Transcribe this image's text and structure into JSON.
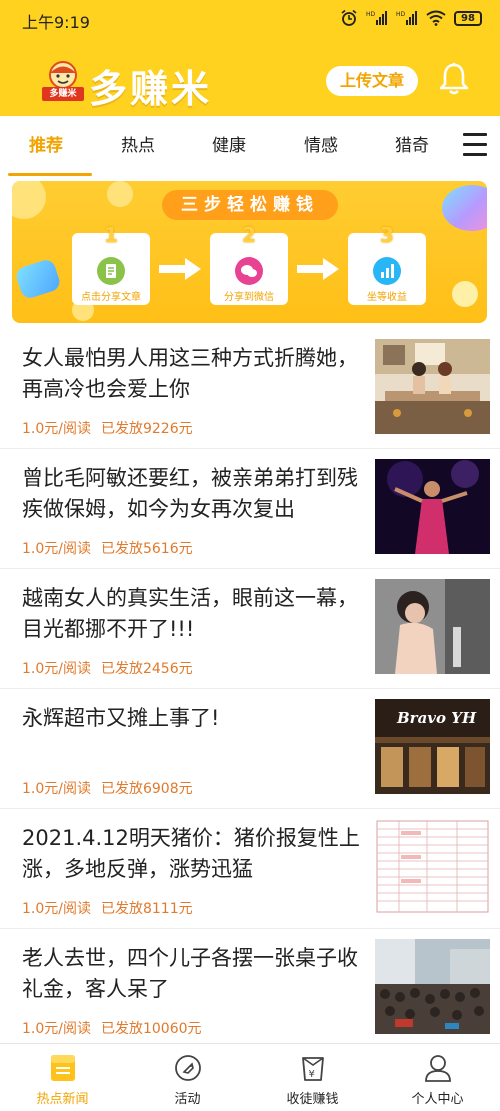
{
  "status_bar": {
    "time": "上午9:19",
    "battery": "98"
  },
  "app": {
    "name": "多赚米",
    "logo_badge": "多赚米",
    "upload_label": "上传文章"
  },
  "tabs": [
    {
      "label": "推荐",
      "active": true
    },
    {
      "label": "热点",
      "active": false
    },
    {
      "label": "健康",
      "active": false
    },
    {
      "label": "情感",
      "active": false
    },
    {
      "label": "猎奇",
      "active": false
    }
  ],
  "banner": {
    "title": "三步轻松赚钱",
    "steps": [
      {
        "num": "1",
        "label": "点击分享文章",
        "icon": "document-icon",
        "color": "#8bc34a"
      },
      {
        "num": "2",
        "label": "分享到微信",
        "icon": "wechat-icon",
        "color": "#e84393"
      },
      {
        "num": "3",
        "label": "坐等收益",
        "icon": "chart-icon",
        "color": "#29b6f6"
      }
    ]
  },
  "articles": [
    {
      "title": "女人最怕男人用这三种方式折腾她，再高冷也会爱上你",
      "price": "1.0元/阅读",
      "paid": "已发放9226元",
      "thumb": "couple-illustration"
    },
    {
      "title": "曾比毛阿敏还要红，被亲弟弟打到残疾做保姆，如今为女再次复出",
      "price": "1.0元/阅读",
      "paid": "已发放5616元",
      "thumb": "singer-stage"
    },
    {
      "title": "越南女人的真实生活，眼前这一幕，目光都挪不开了!!!",
      "price": "1.0元/阅读",
      "paid": "已发放2456元",
      "thumb": "woman-photo"
    },
    {
      "title": "永辉超市又摊上事了!",
      "price": "1.0元/阅读",
      "paid": "已发放6908元",
      "thumb": "supermarket",
      "thumb_text": "Bravo YH"
    },
    {
      "title": "2021.4.12明天猪价：猪价报复性上涨，多地反弹，涨势迅猛",
      "price": "1.0元/阅读",
      "paid": "已发放8111元",
      "thumb": "price-table"
    },
    {
      "title": "老人去世，四个儿子各摆一张桌子收礼金，客人呆了",
      "price": "1.0元/阅读",
      "paid": "已发放10060元",
      "thumb": "village-crowd"
    }
  ],
  "bottom_nav": [
    {
      "label": "热点新闻",
      "icon": "news-icon",
      "active": true
    },
    {
      "label": "活动",
      "icon": "tag-icon",
      "active": false
    },
    {
      "label": "收徒赚钱",
      "icon": "money-bag-icon",
      "active": false
    },
    {
      "label": "个人中心",
      "icon": "person-icon",
      "active": false
    }
  ],
  "colors": {
    "brand_yellow": "#ffd21f",
    "accent_orange": "#f2a400",
    "meta_orange": "#e07a2c"
  }
}
